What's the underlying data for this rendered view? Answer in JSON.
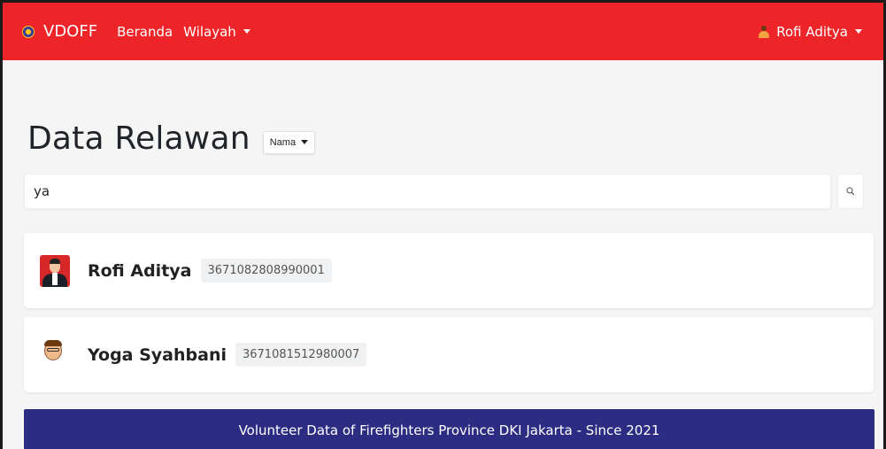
{
  "navbar": {
    "brand": "VDOFF",
    "links": [
      "Beranda",
      "Wilayah"
    ],
    "user_name": "Rofi Aditya",
    "color": "#ee2528"
  },
  "page": {
    "title": "Data Relawan",
    "filter_label": "Nama"
  },
  "search": {
    "value": "ya",
    "icon": "search-icon"
  },
  "results": [
    {
      "name": "Rofi Aditya",
      "id": "3671082808990001",
      "avatar": "photo-avatar"
    },
    {
      "name": "Yoga Syahbani",
      "id": "3671081512980007",
      "avatar": "cartoon-avatar"
    }
  ],
  "footer": {
    "text": "Volunteer Data of Firefighters Province DKI Jakarta - Since 2021",
    "color": "#2c2c83"
  }
}
